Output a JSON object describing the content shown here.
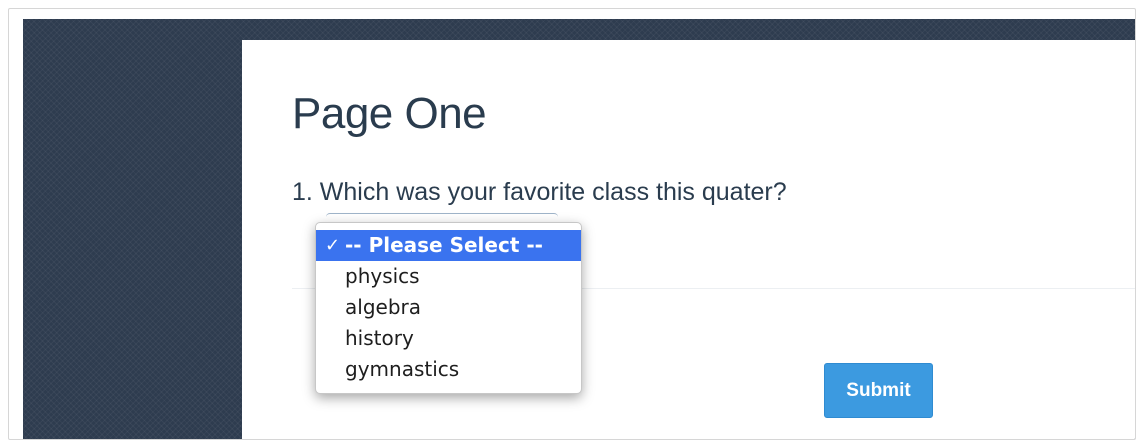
{
  "survey": {
    "page_title": "Page One",
    "question": {
      "number": "1.",
      "text": "1. Which was your favorite class this quater?",
      "dropdown": {
        "selected_option": "-- Please Select --",
        "options": [
          "-- Please Select --",
          "physics",
          "algebra",
          "history",
          "gymnastics"
        ],
        "checkmark_icon": "✓"
      }
    },
    "submit_label": "Submit"
  },
  "colors": {
    "backdrop": "#2e3c4f",
    "title_text": "#2a3c4e",
    "selected_highlight": "#3a73ef",
    "submit_button": "#3c9ae0"
  }
}
